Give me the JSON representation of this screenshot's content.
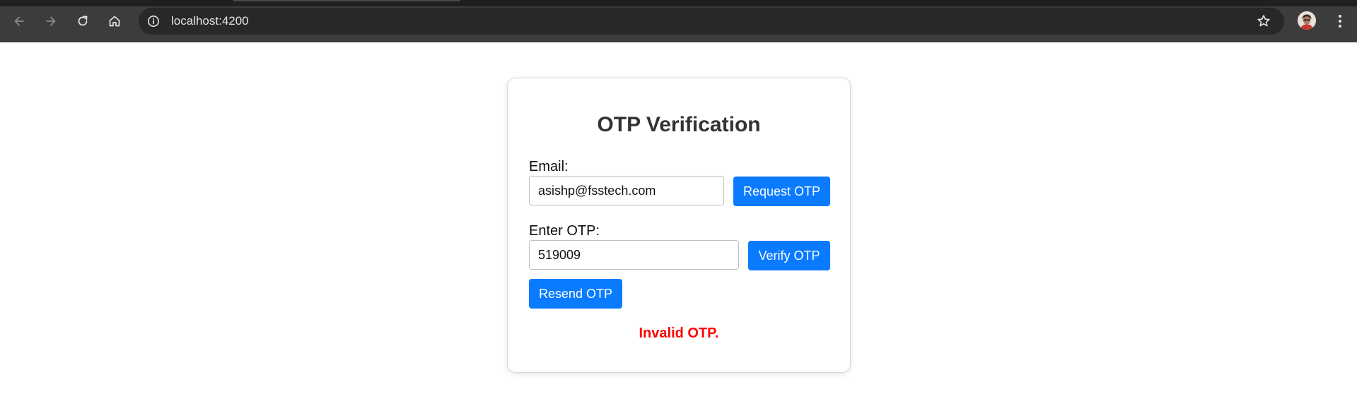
{
  "browser": {
    "url": "localhost:4200",
    "icons": {
      "back": "arrow-left-icon",
      "forward": "arrow-right-icon",
      "reload": "reload-icon",
      "home": "home-icon",
      "site_info": "info-icon",
      "bookmark": "star-icon",
      "profile": "avatar",
      "menu": "kebab-menu-icon"
    }
  },
  "form": {
    "title": "OTP Verification",
    "email_label": "Email:",
    "email_value": "asishp@fsstech.com",
    "request_button": "Request OTP",
    "otp_label": "Enter OTP:",
    "otp_value": "519009",
    "verify_button": "Verify OTP",
    "resend_button": "Resend OTP",
    "status_message": "Invalid OTP."
  },
  "colors": {
    "primary": "#0a7bff",
    "error": "#ff0000",
    "title": "#333333",
    "chrome_bg": "#3c3c3c",
    "omnibox_bg": "#282828"
  }
}
